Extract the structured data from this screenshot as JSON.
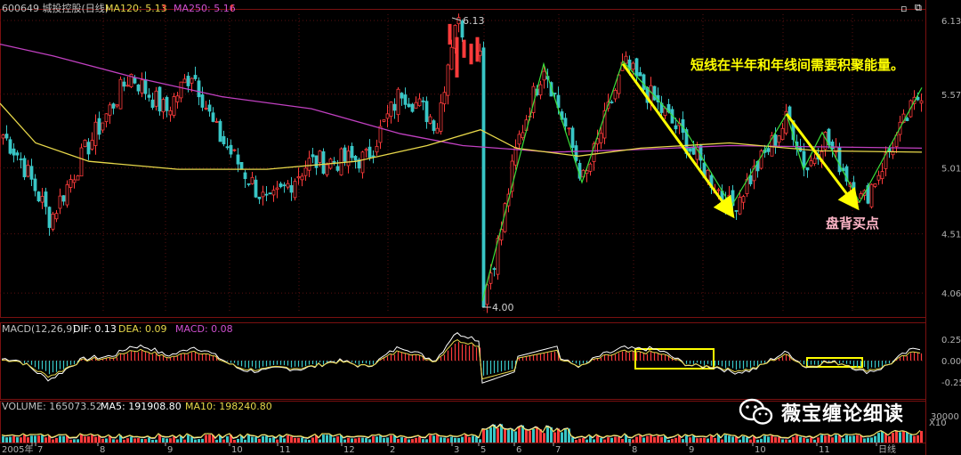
{
  "header": {
    "stock": "600649 城投控股(日线)",
    "ma120_label": "MA120: 5.13",
    "ma250_label": "MA250: 5.16"
  },
  "annotations": {
    "high_label": "6.13",
    "low_label": "4.00",
    "note_top": "短线在半年和年线间需要积聚能量。",
    "note_bottom": "盘背买点"
  },
  "macd": {
    "title": "MACD(12,26,9)",
    "dif": "DIF: 0.13",
    "dea": "DEA: 0.09",
    "macd": "MACD: 0.08"
  },
  "volume": {
    "title": "VOLUME: 165073.52",
    "ma5": "MA5: 191908.80",
    "ma10": "MA10: 198240.80",
    "unit": "X10"
  },
  "watermark": "薇宝缠论细读",
  "colors": {
    "up": "#ff3b3b",
    "down": "#39c6c6",
    "ma120": "#e8d84a",
    "ma250": "#c040c0",
    "stroke_green": "#3adf3a",
    "arrow_yellow": "#ffff00",
    "note_pink": "#ffb6c8"
  },
  "chart_data": {
    "type": "candlestick",
    "price_axis": {
      "ticks": [
        "6.13",
        "5.57",
        "5.01",
        "4.51",
        "4.06"
      ],
      "ylim": [
        4.0,
        6.15
      ]
    },
    "macd_axis": {
      "ticks": [
        "0.25",
        "0.00",
        "-0.25"
      ]
    },
    "volume_axis": {
      "ticks": [
        "30000"
      ]
    },
    "x_ticks": [
      "2005年",
      "7",
      "8",
      "9",
      "10",
      "11",
      "12",
      "2",
      "3",
      "5",
      "6",
      "7",
      "8",
      "9",
      "10",
      "11",
      "日线"
    ],
    "high": 6.13,
    "low": 4.0,
    "ma120_last": 5.13,
    "ma250_last": 5.16
  }
}
